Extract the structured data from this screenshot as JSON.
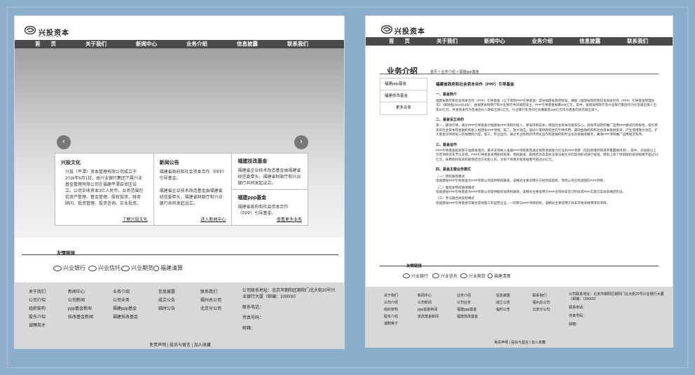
{
  "brand": {
    "name": "兴投资本",
    "sub": "XING TOU ZI BEN"
  },
  "nav": [
    "首　　页",
    "关于我们",
    "新闻中心",
    "业务介绍",
    "信息披露",
    "联系我们"
  ],
  "home": {
    "cards": [
      {
        "title": "兴投文化",
        "text": "兴投（平潭）资本管理有限公司成立于2016年6月1日，由兴业银行集团下属兴业基金管理有限公司在福建平潭自贸区设立。公司实收资本3亿人民币，业务范围包括资产管理、基金管理、股权投资、财务顾问、投资管理、投资咨询、实业投资。",
        "more": "了解兴投文化"
      },
      {
        "title": "新闻公告",
        "text": "福建省政府和社会资本合作（PPP）引导基金。\n\n福建省企业技术改造基金由福建省经信委牵头，福建省财政厅和兴业银行共同发起设立。",
        "more": "进入新闻中心"
      }
    ],
    "col3": [
      {
        "title": "福建技改基金",
        "text": "福建省企业技术改造基金由福建省经信委牵头，福建省财政厅和兴业银行共同发起设立。"
      },
      {
        "title": "福建ppp基金",
        "text": "福建省政府和社会资本合作（PPP）引导基金。",
        "more": "查看更多业务"
      }
    ]
  },
  "links": {
    "label": "友情链接",
    "partners": [
      "兴业银行",
      "兴业信托",
      "兴业期货",
      "福建清算"
    ]
  },
  "footer": {
    "cols": [
      [
        "关于我们",
        "公司介绍",
        "组织架构",
        "股东介绍",
        "诚聘英才"
      ],
      [
        "新闻中心",
        "公司新闻",
        "ppp基金新闻",
        "技改基金新闻"
      ],
      [
        "业务介绍",
        "公司业务",
        "福建ppp基金",
        "福建技改基金"
      ],
      [
        "信息披露",
        "成立公告",
        "临时公告"
      ],
      [
        "联系我们",
        "福州总公司",
        "北京分公司"
      ]
    ],
    "contact": [
      "公司联系地址：北京市朝阳区朝阳门北大街20号兴业银行大厦（邮编：100000）",
      "联系电话：",
      "传真号码：",
      "邮箱："
    ],
    "contact_right": [
      "公司联系地址：北京市朝阳区朝阳门北大街20号兴业银行大厦（邮编：100000）",
      "联系电话：",
      "传真号码：",
      "邮箱："
    ],
    "bottom": "免责声明 | 投诉与留言 | 加入收藏"
  },
  "business": {
    "title": "业务介绍",
    "breadcrumb": "首页 > 业务介绍 > 福建ppp基金",
    "menu": [
      "福建ppp基金",
      "福建技改基金",
      "更多业务"
    ],
    "article": {
      "heading": "福建省政府和社会资本合作（PPP）引导基金",
      "s1_title": "一、基金简介",
      "s1_text": "福建省政府和社会资本合作（PPP）引导基金（以下简称PPP引导基金）是经福建省政府批准，根据《福建省政府和社会资本合作（PPP）引导基金管理办法》（闽财金[2016]34号），由福建省财政厅和兴业银行共同发起设立。PPP引导基金规模200亿元，其中，福建省财政厅及兴业银行集团作为劣后级出资人出资20亿元，共投资未作为普通合伙人期投出资2亿元，兴业银行负责向社会募集第158亿元作为基金的优先级出资人。",
      "s2_title": "二、基金设立目的",
      "s2_text": "第一，撬动引导。通过PPP引导基金对福建省PPP项目的投入，降低项目成本，增强社会资本的投资信心，调动市县政府推广运用PPP模式的积极性，吸引更多的社会资本和金融机构进入福建省PPP领域。第二，放大效应。通过少量财政资金的引导作用，撬动金融机构和社会资本跟进投资，产生倍增放大效应，扩大基金对项目投入的规模和力度。第三，专业运作。通过专业机构的市场化运作和金融机构专业化的投融资服务，确保PPP项目推广运用规范有序。",
      "s3_title": "三、基金运作",
      "s3_text": "PPP引导基金投资限于福建省境内，重点支持纳入省级PPP项目库且通过财政承受能力论证的PPP项目（包括新增项目或存量置换项目），其中，对省级以上示范项目优先予以支持。PPP引导基金采用股权投资、债权融资、股债结合及其他法律法规允许的其他形式进行投资。原则上单个项目股权投资规模不超过10亿元，采用债权投资和股债结合方式投入的，对单个项目的投资规模不超过20亿元。",
      "s4_title": "四、基金主要业务模式",
      "m1_title": "（一）债权融资模式",
      "m1_text": "指福建省PPP引导基金为PPP项目公司提供债权融资。该模式主要适用于已经完成招标，项目公司已经组建的PPP项目。",
      "m2_title": "（二）股权加债权融资模式",
      "m2_text": "指福建省PPP引导基金为PPP项目公司提供股权加债权融资，该模式主要适用于PPP合同尚未签订阶段或PPP实施方案尚未确定阶段。",
      "m3_title": "（三）参与联合体投标模式",
      "m3_text": "指福建省PPP引导基金可联合其他施工和运营企业，一同参与PPP项目招标。该模式主要适用于尚未开始资格预审的项目。"
    }
  }
}
